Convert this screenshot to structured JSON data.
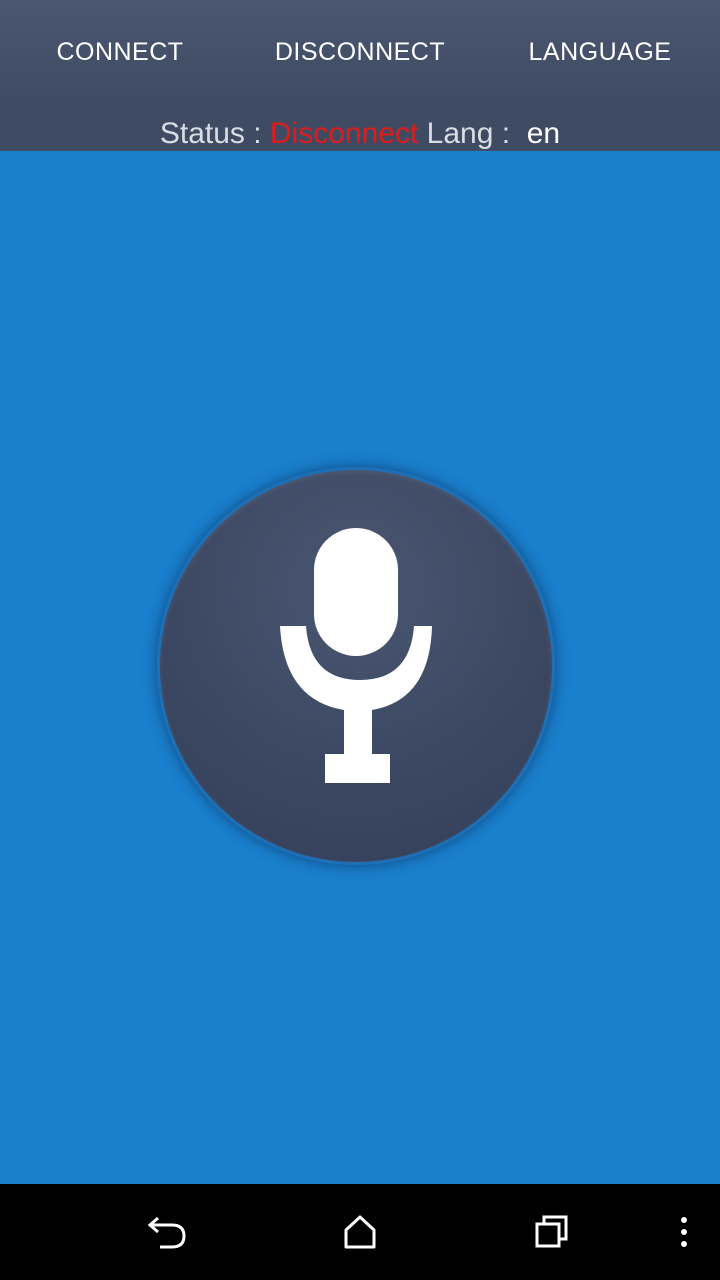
{
  "toolbar": {
    "connect_label": "CONNECT",
    "disconnect_label": "DISCONNECT",
    "language_label": "LANGUAGE"
  },
  "status": {
    "status_label": "Status : ",
    "status_value": "Disconnect",
    "lang_label": " Lang : ",
    "lang_value": " en"
  },
  "mic": {
    "icon": "microphone-icon"
  },
  "navbar": {
    "back_icon": "back-icon",
    "home_icon": "home-icon",
    "recents_icon": "recents-icon",
    "menu_icon": "overflow-menu-icon"
  },
  "colors": {
    "background": "#1a7fcc",
    "toolbar": "#4a5770",
    "status_disconnected": "#e01b1b",
    "mic_button": "#3c4862"
  }
}
